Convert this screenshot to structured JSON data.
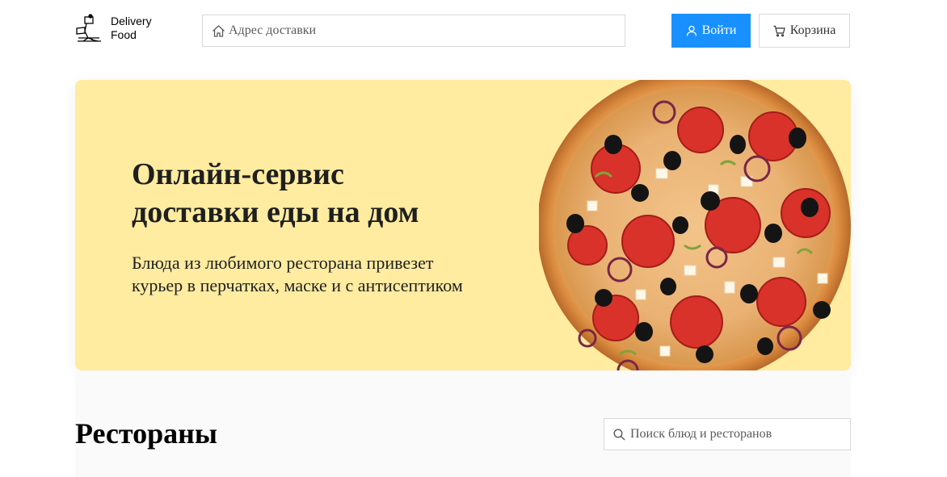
{
  "header": {
    "logo_line1": "Delivery",
    "logo_line2": "Food",
    "address_placeholder": "Адрес доставки",
    "login_label": "Войти",
    "cart_label": "Корзина"
  },
  "promo": {
    "title_line1": "Онлайн-сервис",
    "title_line2": "доставки еды на дом",
    "text_line1": "Блюда из любимого ресторана привезет",
    "text_line2": "курьер в перчатках, маске и с антисептиком"
  },
  "restaurants": {
    "title": "Рестораны",
    "search_placeholder": "Поиск блюд и ресторанов"
  },
  "icons": {
    "logo": "delivery-courier-icon",
    "address": "home-icon",
    "login": "user-icon",
    "cart": "shopping-cart-icon",
    "search": "search-icon"
  },
  "colors": {
    "accent": "#1890ff",
    "promo_background": "#ffeca1",
    "section_background": "#fafafa"
  }
}
